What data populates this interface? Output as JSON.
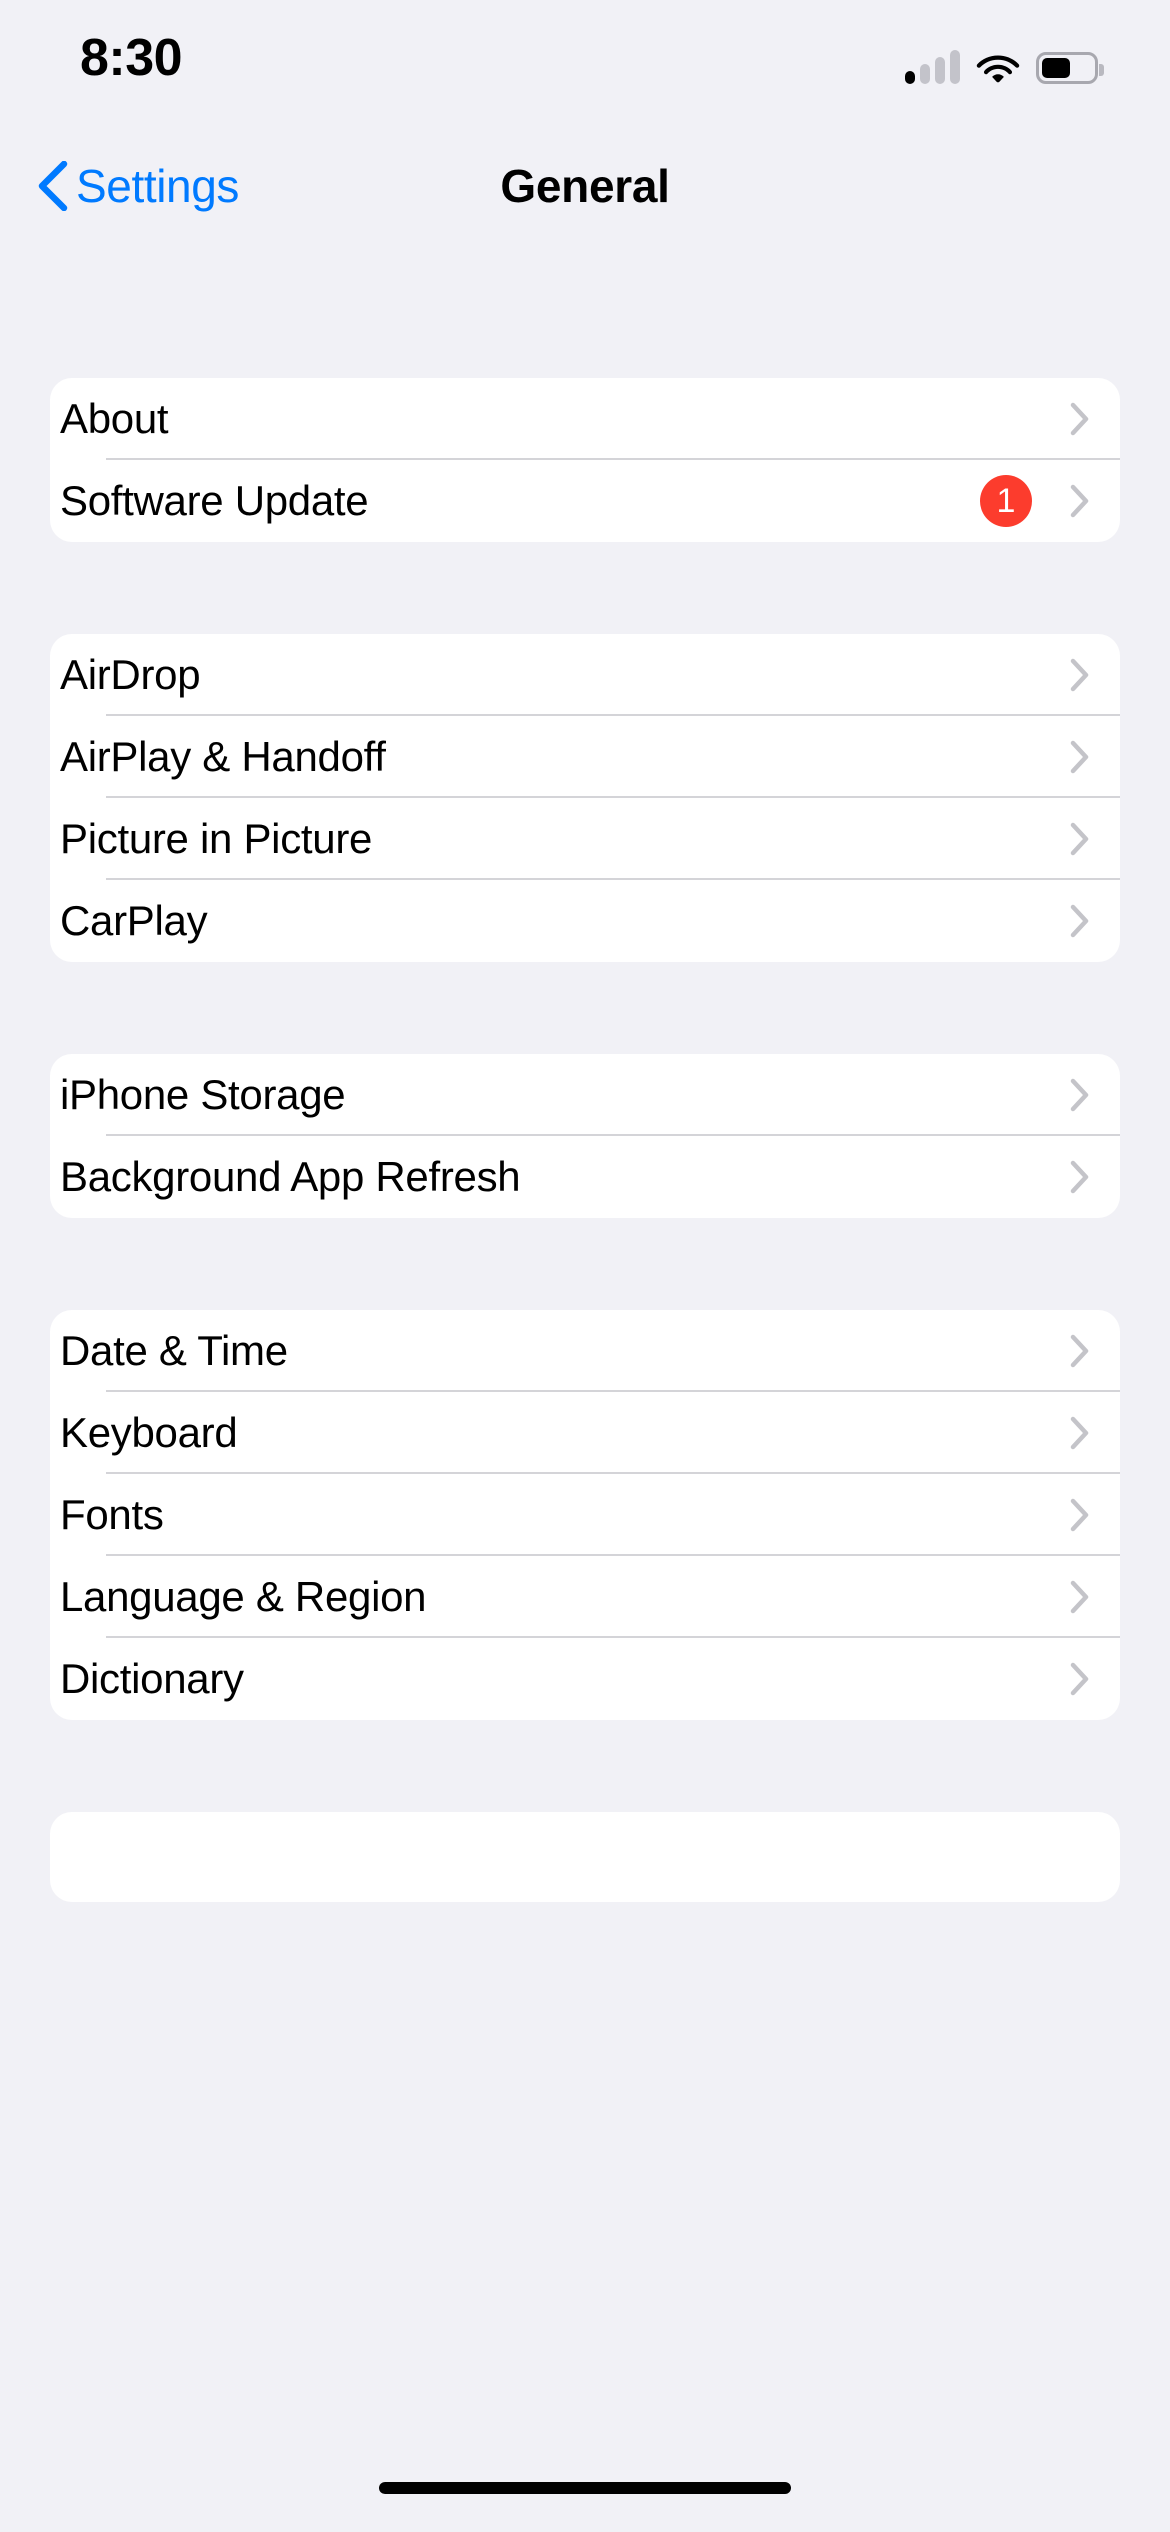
{
  "status_bar": {
    "time": "8:30",
    "cellular_icon": "cellular-signal-icon",
    "cellular_bars_filled": 1,
    "cellular_bars_total": 4,
    "wifi_icon": "wifi-icon",
    "battery_icon": "battery-icon",
    "battery_level_percent": 55
  },
  "nav_bar": {
    "back_icon": "chevron-left-icon",
    "back_label": "Settings",
    "title": "General"
  },
  "colors": {
    "accent_blue": "#007AFF",
    "badge_red": "#FC3C2D",
    "page_background": "#F1F1F6",
    "card_background": "#FFFFFF",
    "separator": "#D4D4D8",
    "chevron_gray": "#C4C4C9"
  },
  "sections": [
    {
      "rows": [
        {
          "label": "About",
          "chevron": "chevron-right-icon"
        },
        {
          "label": "Software Update",
          "badge": "1",
          "chevron": "chevron-right-icon"
        }
      ]
    },
    {
      "rows": [
        {
          "label": "AirDrop",
          "chevron": "chevron-right-icon"
        },
        {
          "label": "AirPlay & Handoff",
          "chevron": "chevron-right-icon"
        },
        {
          "label": "Picture in Picture",
          "chevron": "chevron-right-icon"
        },
        {
          "label": "CarPlay",
          "chevron": "chevron-right-icon"
        }
      ]
    },
    {
      "rows": [
        {
          "label": "iPhone Storage",
          "chevron": "chevron-right-icon"
        },
        {
          "label": "Background App Refresh",
          "chevron": "chevron-right-icon"
        }
      ]
    },
    {
      "rows": [
        {
          "label": "Date & Time",
          "chevron": "chevron-right-icon"
        },
        {
          "label": "Keyboard",
          "chevron": "chevron-right-icon"
        },
        {
          "label": "Fonts",
          "chevron": "chevron-right-icon"
        },
        {
          "label": "Language & Region",
          "chevron": "chevron-right-icon"
        },
        {
          "label": "Dictionary",
          "chevron": "chevron-right-icon"
        }
      ]
    },
    {
      "rows": []
    }
  ],
  "home_indicator": "home-indicator"
}
